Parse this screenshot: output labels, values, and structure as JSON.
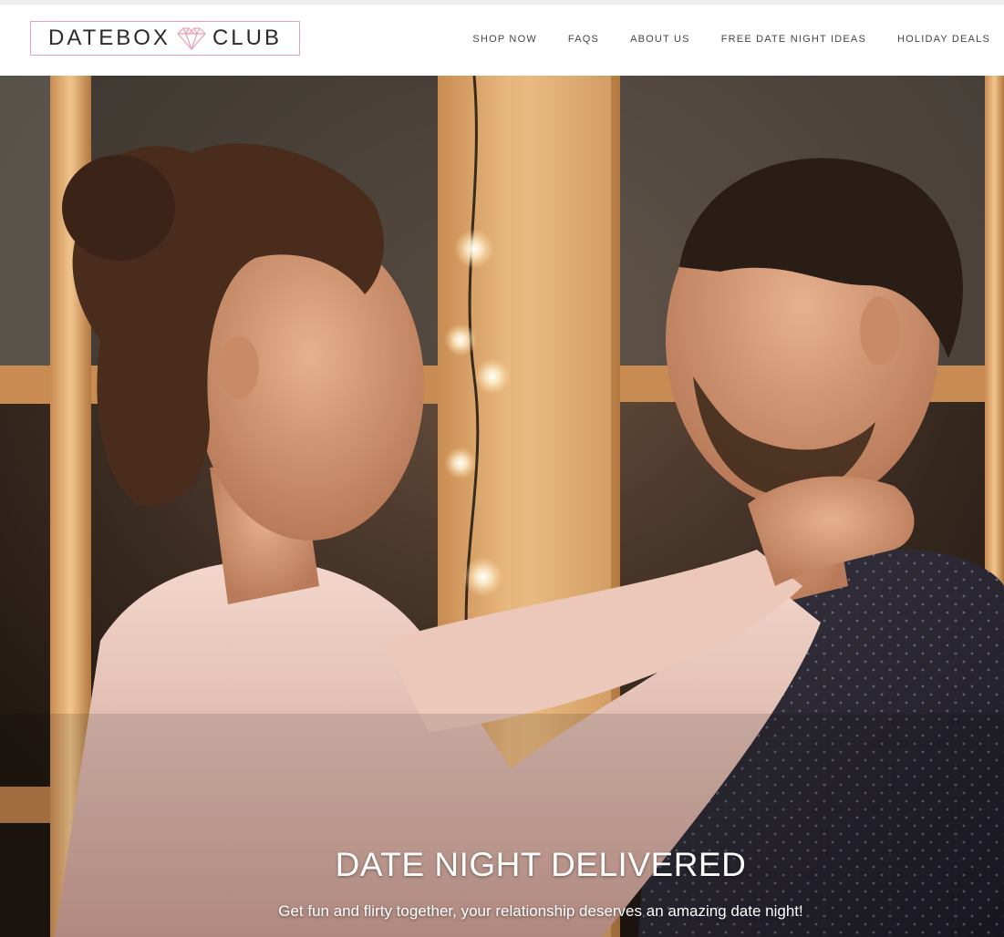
{
  "brand": {
    "logo_left": "DATEBOX",
    "logo_right": "CLUB",
    "logo_icon": "heart-gem-icon",
    "accent_color": "#e8a0b4"
  },
  "nav": {
    "items": [
      {
        "label": "SHOP NOW"
      },
      {
        "label": "FAQS"
      },
      {
        "label": "ABOUT US"
      },
      {
        "label": "FREE DATE NIGHT IDEAS"
      },
      {
        "label": "HOLIDAY DEALS"
      }
    ]
  },
  "hero": {
    "title": "DATE NIGHT DELIVERED",
    "subtitle": "Get fun and flirty together, your relationship deserves an amazing date night!"
  }
}
